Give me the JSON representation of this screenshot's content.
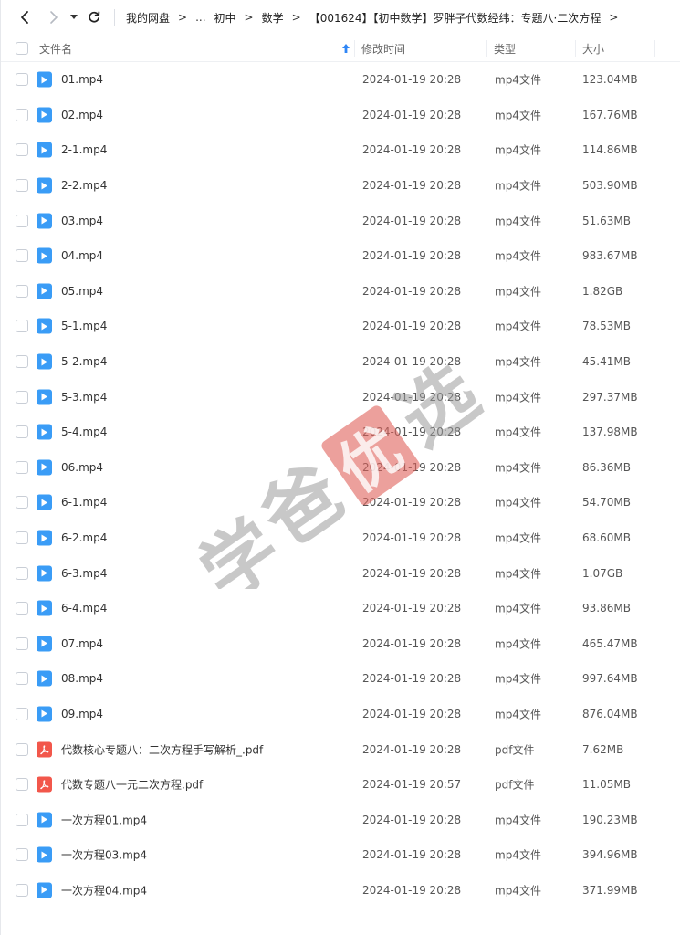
{
  "nav": {
    "back": "chevron-left-icon",
    "forward": "chevron-right-icon",
    "dropdown": "caret-down-icon",
    "refresh": "refresh-icon"
  },
  "breadcrumb": {
    "root": "我的网盘",
    "ellipsis": "...",
    "items": [
      "初中",
      "数学",
      "【001624】【初中数学】罗胖子代数经纬：专题八·二次方程"
    ]
  },
  "table": {
    "columns": {
      "name": "文件名",
      "time": "修改时间",
      "type": "类型",
      "size": "大小"
    },
    "rows": [
      {
        "name": "01.mp4",
        "time": "2024-01-19 20:28",
        "type": "mp4文件",
        "size": "123.04MB",
        "icon": "video"
      },
      {
        "name": "02.mp4",
        "time": "2024-01-19 20:28",
        "type": "mp4文件",
        "size": "167.76MB",
        "icon": "video"
      },
      {
        "name": "2-1.mp4",
        "time": "2024-01-19 20:28",
        "type": "mp4文件",
        "size": "114.86MB",
        "icon": "video"
      },
      {
        "name": "2-2.mp4",
        "time": "2024-01-19 20:28",
        "type": "mp4文件",
        "size": "503.90MB",
        "icon": "video"
      },
      {
        "name": "03.mp4",
        "time": "2024-01-19 20:28",
        "type": "mp4文件",
        "size": "51.63MB",
        "icon": "video"
      },
      {
        "name": "04.mp4",
        "time": "2024-01-19 20:28",
        "type": "mp4文件",
        "size": "983.67MB",
        "icon": "video"
      },
      {
        "name": "05.mp4",
        "time": "2024-01-19 20:28",
        "type": "mp4文件",
        "size": "1.82GB",
        "icon": "video"
      },
      {
        "name": "5-1.mp4",
        "time": "2024-01-19 20:28",
        "type": "mp4文件",
        "size": "78.53MB",
        "icon": "video"
      },
      {
        "name": "5-2.mp4",
        "time": "2024-01-19 20:28",
        "type": "mp4文件",
        "size": "45.41MB",
        "icon": "video"
      },
      {
        "name": "5-3.mp4",
        "time": "2024-01-19 20:28",
        "type": "mp4文件",
        "size": "297.37MB",
        "icon": "video"
      },
      {
        "name": "5-4.mp4",
        "time": "2024-01-19 20:28",
        "type": "mp4文件",
        "size": "137.98MB",
        "icon": "video"
      },
      {
        "name": "06.mp4",
        "time": "2024-01-19 20:28",
        "type": "mp4文件",
        "size": "86.36MB",
        "icon": "video"
      },
      {
        "name": "6-1.mp4",
        "time": "2024-01-19 20:28",
        "type": "mp4文件",
        "size": "54.70MB",
        "icon": "video"
      },
      {
        "name": "6-2.mp4",
        "time": "2024-01-19 20:28",
        "type": "mp4文件",
        "size": "68.60MB",
        "icon": "video"
      },
      {
        "name": "6-3.mp4",
        "time": "2024-01-19 20:28",
        "type": "mp4文件",
        "size": "1.07GB",
        "icon": "video"
      },
      {
        "name": "6-4.mp4",
        "time": "2024-01-19 20:28",
        "type": "mp4文件",
        "size": "93.86MB",
        "icon": "video"
      },
      {
        "name": "07.mp4",
        "time": "2024-01-19 20:28",
        "type": "mp4文件",
        "size": "465.47MB",
        "icon": "video"
      },
      {
        "name": "08.mp4",
        "time": "2024-01-19 20:28",
        "type": "mp4文件",
        "size": "997.64MB",
        "icon": "video"
      },
      {
        "name": "09.mp4",
        "time": "2024-01-19 20:28",
        "type": "mp4文件",
        "size": "876.04MB",
        "icon": "video"
      },
      {
        "name": "代数核心专题八：二次方程手写解析_.pdf",
        "time": "2024-01-19 20:28",
        "type": "pdf文件",
        "size": "7.62MB",
        "icon": "pdf"
      },
      {
        "name": "代数专题八一元二次方程.pdf",
        "time": "2024-01-19 20:57",
        "type": "pdf文件",
        "size": "11.05MB",
        "icon": "pdf"
      },
      {
        "name": "一次方程01.mp4",
        "time": "2024-01-19 20:28",
        "type": "mp4文件",
        "size": "190.23MB",
        "icon": "video"
      },
      {
        "name": "一次方程03.mp4",
        "time": "2024-01-19 20:28",
        "type": "mp4文件",
        "size": "394.96MB",
        "icon": "video"
      },
      {
        "name": "一次方程04.mp4",
        "time": "2024-01-19 20:28",
        "type": "mp4文件",
        "size": "371.99MB",
        "icon": "video"
      }
    ]
  },
  "watermark": {
    "text": "学爸优选"
  },
  "colors": {
    "video_icon": "#3a9cf6",
    "pdf_icon": "#f2574b",
    "sort_arrow": "#2f86f6"
  }
}
